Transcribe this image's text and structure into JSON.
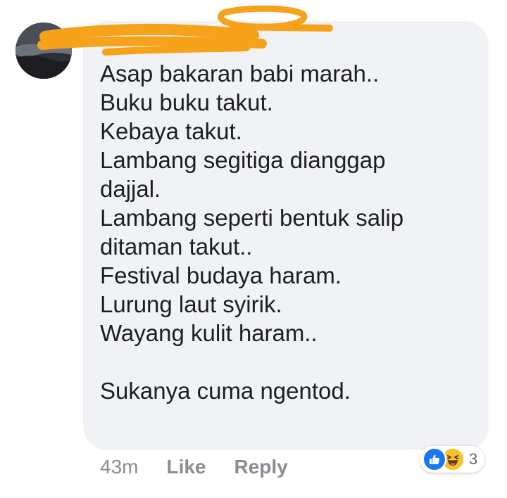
{
  "comment": {
    "author_name": "",
    "lines": [
      "Asap bakaran babi marah..",
      "Buku buku takut.",
      "Kebaya takut.",
      "Lambang segitiga dianggap",
      "dajjal.",
      "Lambang seperti bentuk salip",
      "ditaman takut..",
      "Festival budaya haram.",
      "Lurung laut syirik.",
      "Wayang kulit haram..",
      "",
      "Sukanya cuma ngentod."
    ],
    "time": "43m",
    "like_label": "Like",
    "reply_label": "Reply",
    "reaction_icons": [
      "like-icon",
      "haha-icon"
    ],
    "reaction_count": "3"
  },
  "colors": {
    "bubble": "#f1f2f5",
    "redaction": "#f7a21b",
    "like_blue": "#1877f2",
    "haha_yellow": "#f7c12e",
    "meta_gray": "#8a8d91"
  }
}
